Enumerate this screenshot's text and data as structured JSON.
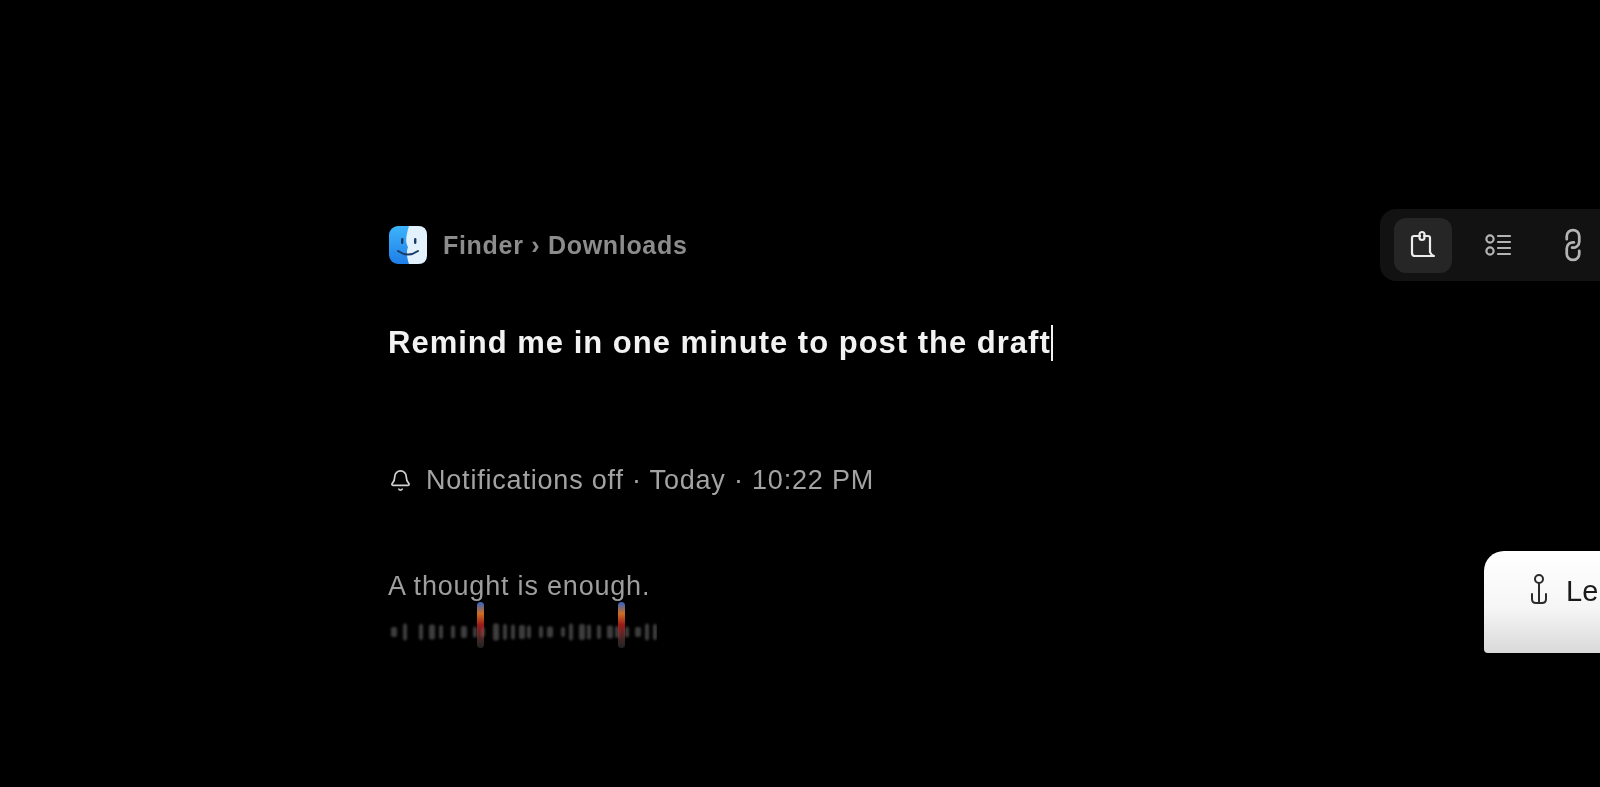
{
  "header": {
    "breadcrumb": "Finder › Downloads"
  },
  "reminder_input": {
    "value": "Remind me in one minute to post the draft",
    "focused": true
  },
  "status_line": "Notifications off · Today · 10:22 PM",
  "tagline": "A thought is enough.",
  "toolbar": {
    "tabs": [
      {
        "kind": "note",
        "selected": true
      },
      {
        "kind": "list",
        "selected": false
      },
      {
        "kind": "link",
        "selected": false
      }
    ]
  },
  "card": {
    "label": "Le"
  }
}
